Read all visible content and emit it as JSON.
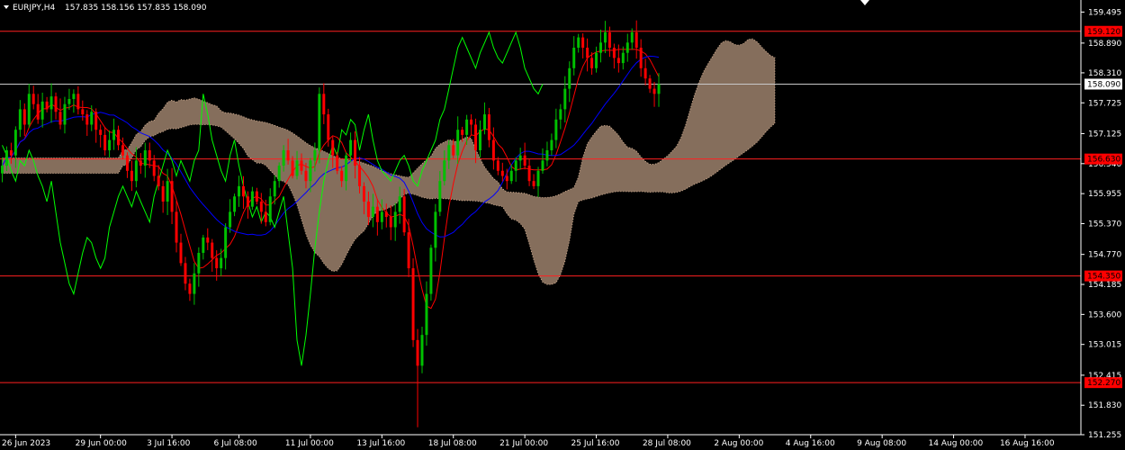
{
  "header": {
    "symbol": "EURJPY,H4",
    "ohlc": "157.835 158.156 157.835 158.090"
  },
  "colors": {
    "background": "#000000",
    "bull": "#00c000",
    "bear": "#ff0000",
    "tenkan": "#ff0000",
    "kijun": "#0000ff",
    "chikou": "#00ff00",
    "cloud": "#f2c9a8",
    "level_line": "#ff2020",
    "price_line": "#c8c8c8",
    "axis": "#ffffff"
  },
  "chart_data": {
    "type": "candlestick",
    "y_range": [
      151.255,
      159.73
    ],
    "x_range": [
      0,
      242
    ],
    "y_ticks": [
      "159.495",
      "158.890",
      "158.310",
      "157.725",
      "157.125",
      "156.540",
      "155.955",
      "155.370",
      "154.770",
      "154.185",
      "153.600",
      "153.015",
      "152.415",
      "151.830",
      "151.255"
    ],
    "x_ticks": [
      {
        "i": 3,
        "label": "26 Jun 2023"
      },
      {
        "i": 22,
        "label": "29 Jun 00:00"
      },
      {
        "i": 38,
        "label": "3 Jul 16:00"
      },
      {
        "i": 53,
        "label": "6 Jul 08:00"
      },
      {
        "i": 69,
        "label": "11 Jul 00:00"
      },
      {
        "i": 85,
        "label": "13 Jul 16:00"
      },
      {
        "i": 101,
        "label": "18 Jul 08:00"
      },
      {
        "i": 117,
        "label": "21 Jul 00:00"
      },
      {
        "i": 133,
        "label": "25 Jul 16:00"
      },
      {
        "i": 149,
        "label": "28 Jul 08:00"
      },
      {
        "i": 165,
        "label": "2 Aug 00:00"
      },
      {
        "i": 181,
        "label": "4 Aug 16:00"
      },
      {
        "i": 197,
        "label": "9 Aug 08:00"
      },
      {
        "i": 213,
        "label": "14 Aug 00:00"
      },
      {
        "i": 229,
        "label": "16 Aug 16:00"
      }
    ],
    "levels": [
      {
        "value": 159.12,
        "label": "159.120"
      },
      {
        "value": 156.63,
        "label": "156.630"
      },
      {
        "value": 154.35,
        "label": "154.350"
      },
      {
        "value": 152.27,
        "label": "152.270"
      }
    ],
    "current_price": {
      "value": 158.09,
      "label": "158.090"
    },
    "close": [
      156.5,
      156.8,
      156.7,
      157.2,
      157.6,
      157.3,
      157.9,
      157.7,
      157.4,
      157.75,
      157.6,
      157.85,
      157.55,
      157.3,
      157.7,
      157.8,
      157.9,
      157.6,
      157.5,
      157.3,
      157.55,
      157.2,
      157.1,
      156.8,
      157.0,
      157.2,
      156.9,
      156.7,
      156.4,
      156.2,
      156.6,
      156.5,
      156.8,
      156.6,
      156.3,
      156.1,
      155.8,
      156.2,
      155.6,
      155.0,
      154.6,
      154.2,
      154.0,
      154.4,
      154.8,
      155.1,
      155.0,
      154.7,
      154.5,
      154.7,
      155.3,
      155.6,
      155.9,
      156.1,
      155.9,
      155.7,
      156.0,
      155.8,
      155.6,
      155.4,
      155.9,
      156.2,
      156.5,
      156.8,
      156.6,
      156.3,
      156.6,
      156.4,
      156.2,
      156.6,
      156.8,
      157.9,
      157.5,
      157.0,
      156.7,
      156.4,
      156.2,
      156.7,
      157.0,
      156.5,
      156.1,
      155.8,
      155.5,
      155.7,
      155.4,
      155.6,
      155.5,
      155.3,
      155.6,
      155.9,
      155.2,
      154.5,
      153.1,
      152.6,
      153.2,
      154.0,
      154.9,
      155.6,
      156.2,
      156.6,
      156.9,
      156.7,
      157.2,
      157.1,
      157.4,
      157.3,
      156.8,
      157.2,
      157.5,
      157.0,
      156.6,
      156.4,
      156.3,
      156.2,
      156.4,
      156.6,
      156.7,
      156.5,
      156.2,
      156.1,
      156.4,
      156.6,
      156.8,
      157.0,
      157.4,
      157.6,
      158.0,
      158.4,
      158.8,
      159.0,
      158.8,
      158.6,
      158.4,
      158.7,
      158.9,
      159.1,
      158.8,
      158.6,
      158.5,
      158.7,
      158.9,
      159.1,
      158.8,
      158.4,
      158.2,
      158.0,
      157.9,
      158.09
    ]
  }
}
